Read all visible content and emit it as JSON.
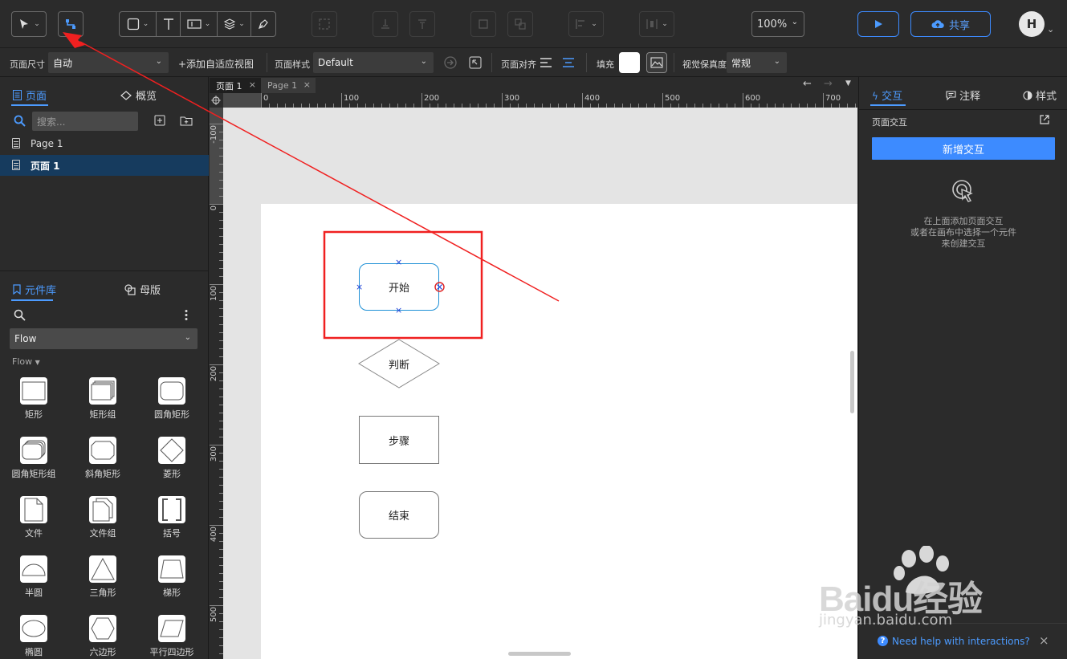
{
  "toolbar": {
    "zoom": "100%",
    "share_label": "共享",
    "avatar_initial": "H"
  },
  "propbar": {
    "page_size_label": "页面尺寸",
    "page_size_value": "自动",
    "add_adaptive_view": "+添加自适应视图",
    "page_style_label": "页面样式",
    "page_style_value": "Default",
    "page_align_label": "页面对齐",
    "fill_label": "填充",
    "visual_fidelity_label": "视觉保真度",
    "visual_fidelity_value": "常规"
  },
  "left": {
    "tab_pages": "页面",
    "tab_overview": "概览",
    "search_placeholder": "搜索...",
    "pages": [
      "Page 1",
      "页面 1"
    ],
    "tab_library": "元件库",
    "tab_masters": "母版",
    "library_select": "Flow",
    "library_group": "Flow",
    "items": [
      "矩形",
      "矩形组",
      "圆角矩形",
      "圆角矩形组",
      "斜角矩形",
      "菱形",
      "文件",
      "文件组",
      "括号",
      "半圆",
      "三角形",
      "梯形",
      "椭圆",
      "六边形",
      "平行四边形"
    ]
  },
  "canvas": {
    "doc_tabs": [
      "页面 1",
      "Page 1"
    ],
    "ruler_h": [
      "0",
      "100",
      "200",
      "300",
      "400",
      "500",
      "600",
      "700"
    ],
    "ruler_v": [
      "-100",
      "0",
      "100",
      "200",
      "300",
      "400",
      "500"
    ],
    "shapes": {
      "start": "开始",
      "decision": "判断",
      "step": "步骤",
      "end": "结束"
    }
  },
  "right": {
    "tab_interaction": "交互",
    "tab_notes": "注释",
    "tab_style": "样式",
    "page_interaction": "页面交互",
    "add_interaction": "新增交互",
    "hint_lines": [
      "在上面添加页面交互",
      "或者在画布中选择一个元件",
      "来创建交互"
    ],
    "help_link": "Need help with interactions?"
  },
  "watermark": {
    "text": "Baidu经验",
    "url": "jingyan.baidu.com"
  },
  "colors": {
    "accent": "#3d8bff",
    "annotation": "#f02020",
    "panel_bg": "#2b2b2b"
  }
}
